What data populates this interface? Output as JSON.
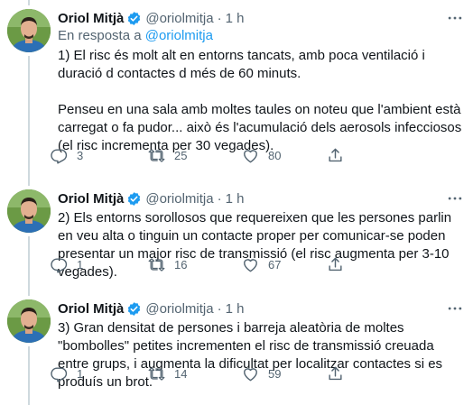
{
  "colors": {
    "accent": "#1d9bf0",
    "muted": "#536471",
    "text": "#0f1419",
    "line": "#cfd9de"
  },
  "tweets": [
    {
      "author": "Oriol Mitjà",
      "handle": "@oriolmitja",
      "separator": "·",
      "time": "1 h",
      "reply_prefix": "En resposta a ",
      "reply_handle": "@oriolmitja",
      "text": "1) El risc és molt alt en entorns tancats, amb poca ventilació i duració d contactes d més de 60 minuts.\n\nPenseu en una sala amb moltes taules on noteu que l'ambient està carregat o fa pudor... això és l'acumulació dels aerosols infecciosos (el risc incrementa per 30 vegades).",
      "replies": "3",
      "retweets": "25",
      "likes": "80"
    },
    {
      "author": "Oriol Mitjà",
      "handle": "@oriolmitja",
      "separator": "·",
      "time": "1 h",
      "text": "2) Els entorns sorollosos que requereixen que les persones parlin en veu alta o tinguin un contacte proper per comunicar-se poden presentar un major risc de transmissió (el risc augmenta per 3-10 vegades).",
      "replies": "1",
      "retweets": "16",
      "likes": "67"
    },
    {
      "author": "Oriol Mitjà",
      "handle": "@oriolmitja",
      "separator": "·",
      "time": "1 h",
      "text": "3) Gran densitat de persones i barreja aleatòria de moltes \"bombolles\" petites incrementen el risc de transmissió creuada entre grups, i augmenta la dificultat per localitzar contactes si es produís un brot.",
      "replies": "1",
      "retweets": "14",
      "likes": "59"
    }
  ]
}
